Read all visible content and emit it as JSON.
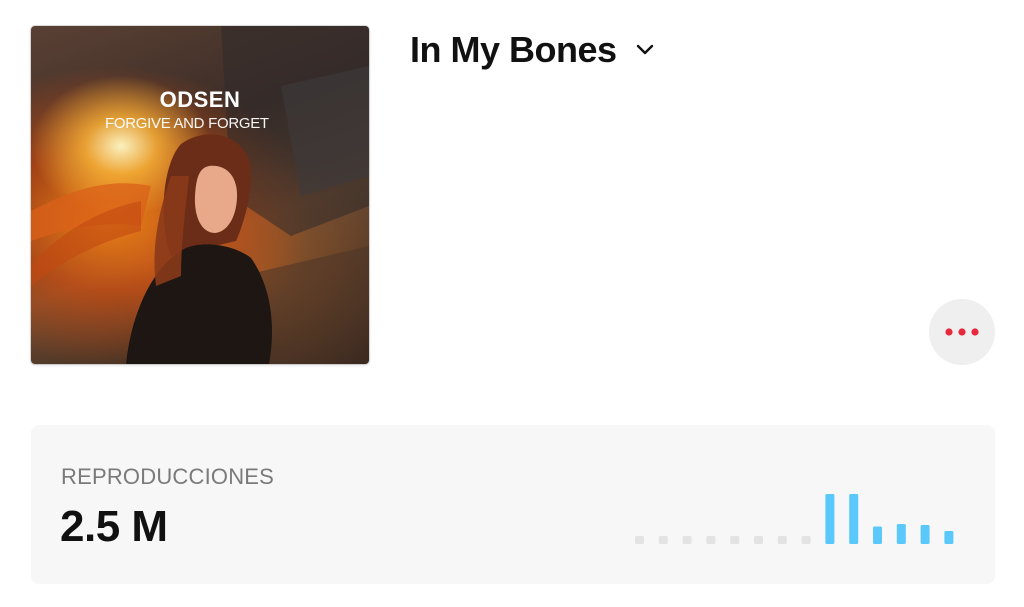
{
  "artwork": {
    "artist_text": "ODSEN",
    "album_text": "FORGIVE AND FORGET"
  },
  "song": {
    "title": "In My Bones"
  },
  "colors": {
    "more_dots": "#e8293b",
    "bar_active": "#5ac8fa",
    "bar_inactive": "#e3e3e3"
  },
  "stats": {
    "label": "REPRODUCCIONES",
    "value": "2.5 M"
  },
  "chart_data": {
    "type": "bar",
    "values": [
      0,
      0,
      0,
      0,
      0,
      0,
      0,
      0,
      1.0,
      1.0,
      0.35,
      0.4,
      0.38,
      0.26
    ],
    "active_from_index": 8,
    "ylim": [
      0,
      1
    ]
  }
}
